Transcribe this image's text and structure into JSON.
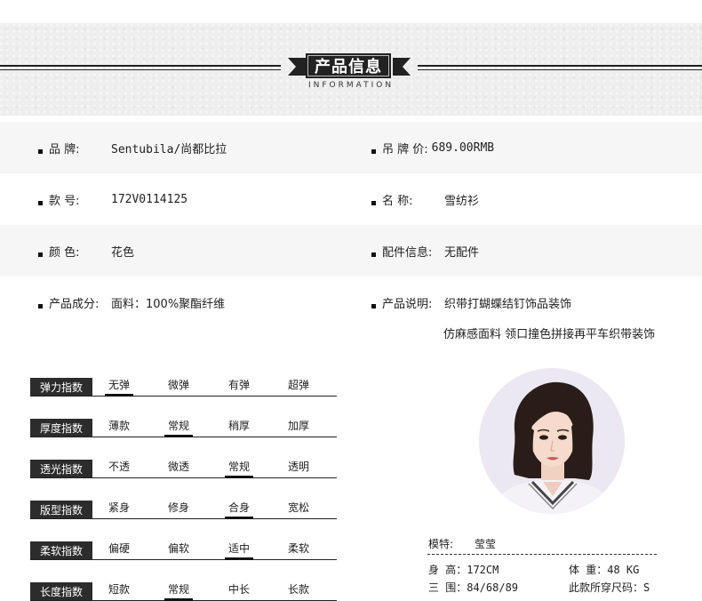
{
  "header": {
    "title": "产品信息",
    "subtitle": "INFORMATION"
  },
  "info": {
    "brand": {
      "label": "品    牌:",
      "value": "Sentubila/尚都比拉"
    },
    "tag_price": {
      "label": "吊 牌 价:",
      "value": "689.00RMB"
    },
    "style_no": {
      "label": "款    号:",
      "value": "172V0114125"
    },
    "name": {
      "label": "名    称:",
      "value": "雪纺衫"
    },
    "color": {
      "label": "颜    色:",
      "value": "花色"
    },
    "accessory": {
      "label": "配件信息:",
      "value": "无配件"
    },
    "material": {
      "label": "产品成分:",
      "value": "面料：100%聚酯纤维"
    },
    "desc": {
      "label": "产品说明:",
      "value": "织带打蝴蝶结钉饰品装饰",
      "value2": "仿麻感面料 领口撞色拼接再平车织带装饰"
    }
  },
  "indices": [
    {
      "name": "弹力指数",
      "options": [
        "无弹",
        "微弹",
        "有弹",
        "超弹"
      ],
      "selected": "无弹"
    },
    {
      "name": "厚度指数",
      "options": [
        "薄款",
        "常规",
        "稍厚",
        "加厚"
      ],
      "selected": "常规"
    },
    {
      "name": "透光指数",
      "options": [
        "不透",
        "微透",
        "常规",
        "透明"
      ],
      "selected": "常规"
    },
    {
      "name": "版型指数",
      "options": [
        "紧身",
        "修身",
        "合身",
        "宽松"
      ],
      "selected": "合身"
    },
    {
      "name": "柔软指数",
      "options": [
        "偏硬",
        "偏软",
        "适中",
        "柔软"
      ],
      "selected": "适中"
    },
    {
      "name": "长度指数",
      "options": [
        "短款",
        "常规",
        "中长",
        "长款"
      ],
      "selected": "常规"
    }
  ],
  "model": {
    "label": "模特:",
    "name": "莹莹",
    "height": "身 高：172CM",
    "weight": "体 重：48 KG",
    "measurements": "三 围：84/68/89",
    "size": "此款所穿尺码：S"
  },
  "colors": {
    "accent": "#2c2c2c",
    "row_shade": "#f6f6f6",
    "header_bg": "#eeeeee"
  }
}
